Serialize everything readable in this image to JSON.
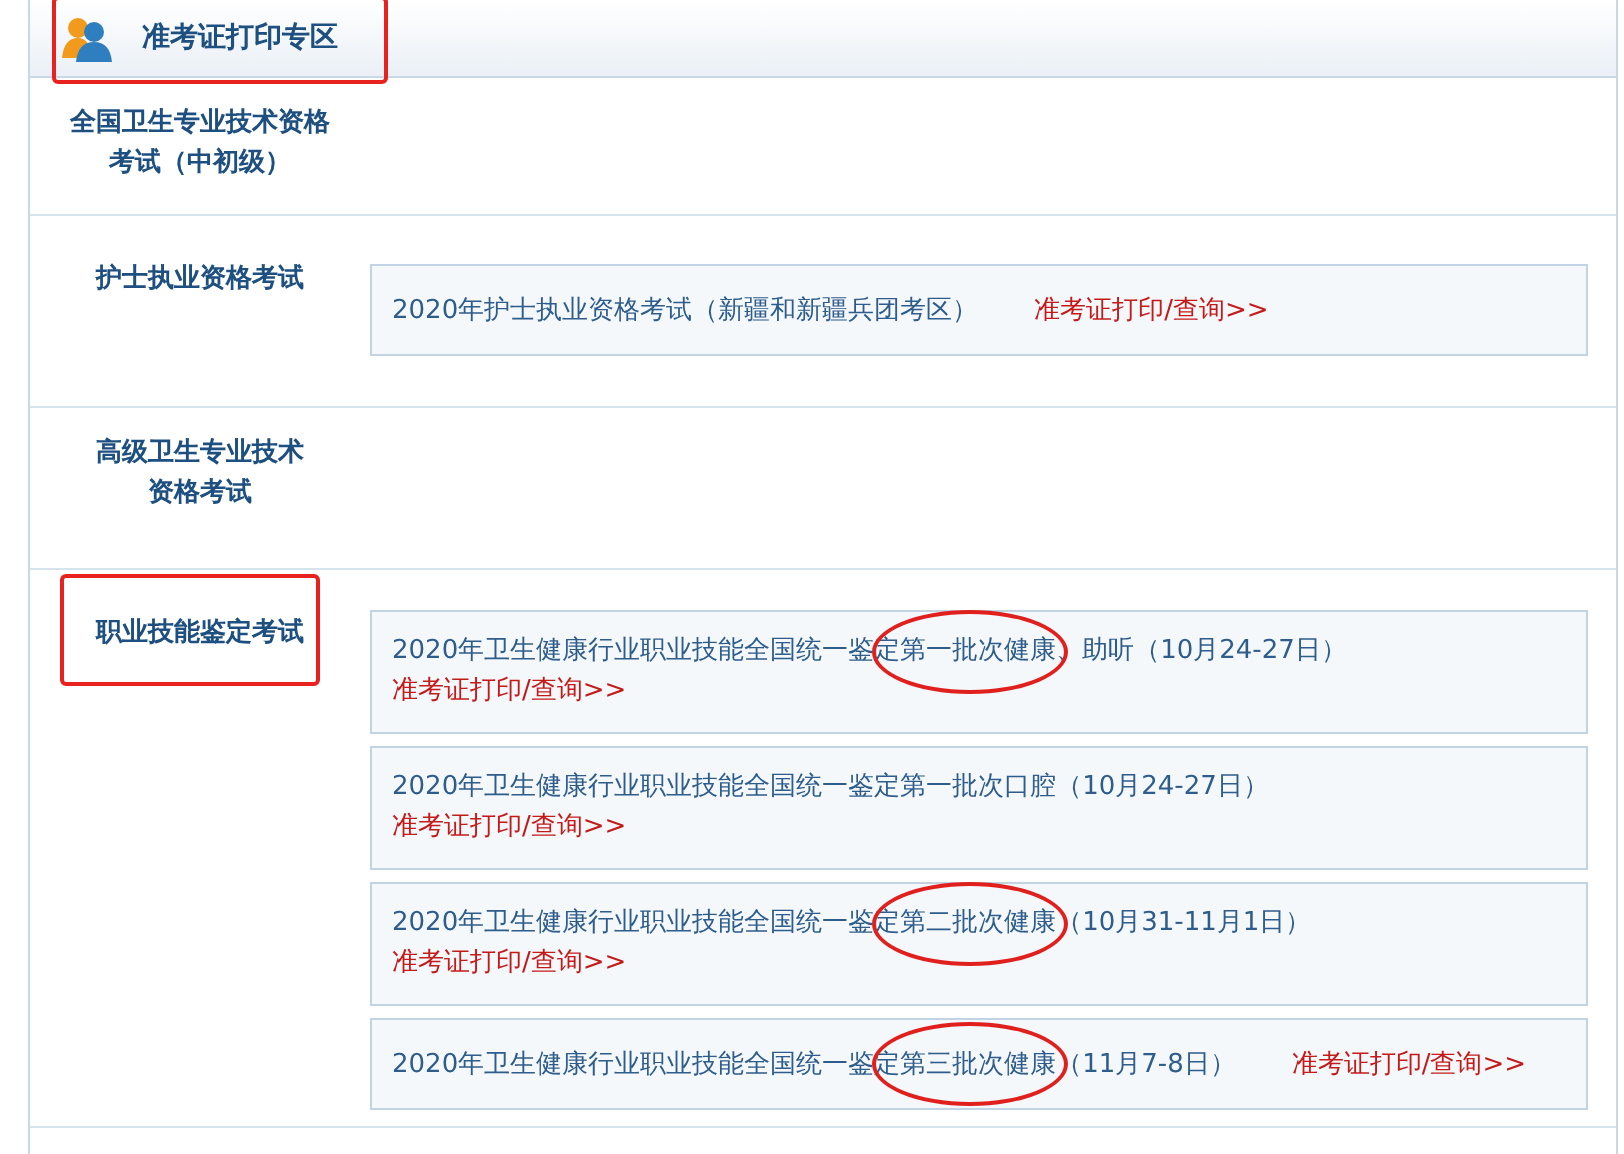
{
  "header": {
    "title": "准考证打印专区",
    "highlighted": true
  },
  "sections": [
    {
      "title_lines": [
        "全国卫生专业技术资格",
        "考试（中初级）"
      ],
      "highlighted": false
    },
    {
      "title_lines": [
        "护士执业资格考试"
      ],
      "highlighted": false,
      "items": [
        {
          "kind": "one-line",
          "text": "2020年护士执业资格考试（新疆和新疆兵团考区）",
          "link": "准考证打印/查询>>",
          "circled": false
        }
      ]
    },
    {
      "title_lines": [
        "高级卫生专业技术",
        "资格考试"
      ],
      "highlighted": false
    },
    {
      "title_lines": [
        "职业技能鉴定考试"
      ],
      "highlighted": true,
      "items": [
        {
          "kind": "two-line",
          "text": "2020年卫生健康行业职业技能全国统一鉴定第一批次健康、助听（10月24-27日）",
          "link": "准考证打印/查询>>",
          "circled": true
        },
        {
          "kind": "two-line",
          "text": "2020年卫生健康行业职业技能全国统一鉴定第一批次口腔（10月24-27日）",
          "link": "准考证打印/查询>>",
          "circled": false
        },
        {
          "kind": "two-line",
          "text": "2020年卫生健康行业职业技能全国统一鉴定第二批次健康（10月31-11月1日）",
          "link": "准考证打印/查询>>",
          "circled": true
        },
        {
          "kind": "one-line",
          "text": "2020年卫生健康行业职业技能全国统一鉴定第三批次健康（11月7-8日）",
          "link": "准考证打印/查询>>",
          "circled": true
        }
      ]
    }
  ]
}
